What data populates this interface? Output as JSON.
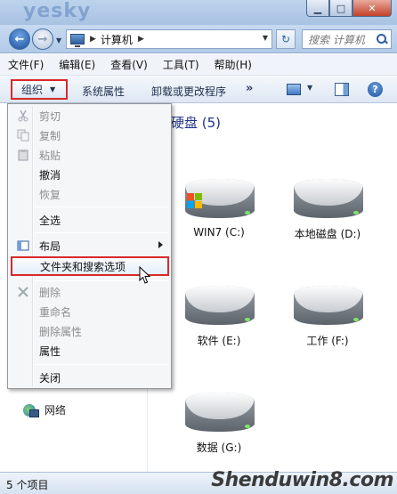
{
  "window": {
    "watermark": "yesky"
  },
  "nav": {
    "address_path": "计算机",
    "search_placeholder": "搜索 计算机"
  },
  "menubar": [
    "文件(F)",
    "编辑(E)",
    "查看(V)",
    "工具(T)",
    "帮助(H)"
  ],
  "toolbar": {
    "organize": "组织",
    "system_properties": "系统属性",
    "uninstall": "卸载或更改程序",
    "more": "»"
  },
  "group_title": "硬盘 (5)",
  "drives": [
    {
      "label": "WIN7 (C:)",
      "system": true
    },
    {
      "label": "本地磁盘 (D:)",
      "system": false
    },
    {
      "label": "软件 (E:)",
      "system": false
    },
    {
      "label": "工作 (F:)",
      "system": false
    },
    {
      "label": "数据 (G:)",
      "system": false
    }
  ],
  "nav_pane": {
    "network": "网络"
  },
  "context_menu": {
    "cut": "剪切",
    "copy": "复制",
    "paste": "粘贴",
    "undo": "撤消",
    "redo": "恢复",
    "select_all": "全选",
    "layout": "布局",
    "folder_options": "文件夹和搜索选项",
    "delete": "删除",
    "rename": "重命名",
    "remove_properties": "删除属性",
    "properties": "属性",
    "close": "关闭"
  },
  "status": {
    "items": "5 个项目"
  },
  "watermark_bottom": "Shenduwin8.com",
  "colors": {
    "highlight_border": "#d9292b",
    "group_title": "#1e3287",
    "window_chrome": "#b2cae8"
  }
}
